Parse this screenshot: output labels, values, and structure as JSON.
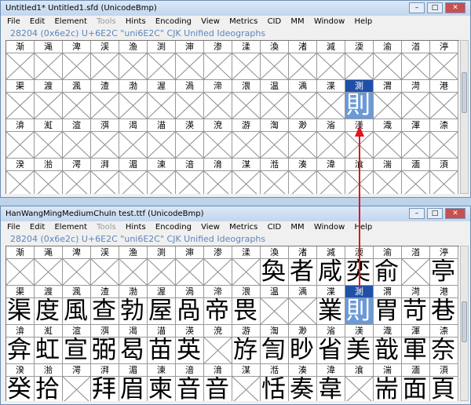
{
  "windows": [
    {
      "title": "Untitled1*  Untitled1.sfd (UnicodeBmp)",
      "menu": [
        "File",
        "Edit",
        "Element",
        "Tools",
        "Hints",
        "Encoding",
        "View",
        "Metrics",
        "CID",
        "MM",
        "Window",
        "Help"
      ],
      "info": "28204 (0x6e2c) U+6E2C \"uni6E2C\" CJK Unified Ideographs",
      "rows": [
        {
          "labels": [
            "渐",
            "渑",
            "渒",
            "渓",
            "渔",
            "渕",
            "渖",
            "渗",
            "渘",
            "渙",
            "渚",
            "減",
            "渜",
            "渝",
            "渞",
            "渟"
          ],
          "glyphs": [
            "",
            "",
            "",
            "",
            "",
            "",
            "",
            "",
            "",
            "",
            "",
            "",
            "",
            "",
            "",
            ""
          ]
        },
        {
          "labels": [
            "渠",
            "渡",
            "渢",
            "渣",
            "渤",
            "渥",
            "渦",
            "渧",
            "渨",
            "温",
            "渪",
            "渫",
            "測",
            "渭",
            "渮",
            "港"
          ],
          "glyphs": [
            "",
            "",
            "",
            "",
            "",
            "",
            "",
            "",
            "",
            "",
            "",
            "",
            "則",
            "",
            "",
            ""
          ]
        },
        {
          "labels": [
            "渰",
            "渱",
            "渲",
            "渳",
            "渴",
            "渵",
            "渶",
            "渷",
            "游",
            "渹",
            "渺",
            "渻",
            "渼",
            "渽",
            "渾",
            "渿"
          ],
          "glyphs": [
            "",
            "",
            "",
            "",
            "",
            "",
            "",
            "",
            "",
            "",
            "",
            "",
            "",
            "",
            "",
            ""
          ]
        },
        {
          "labels": [
            "湀",
            "湁",
            "湂",
            "湃",
            "湄",
            "湅",
            "湆",
            "湇",
            "湈",
            "湉",
            "湊",
            "湋",
            "湌",
            "湍",
            "湎",
            "湏"
          ],
          "glyphs": [
            "",
            "",
            "",
            "",
            "",
            "",
            "",
            "",
            "",
            "",
            "",
            "",
            "",
            "",
            "",
            ""
          ]
        }
      ],
      "selected_row": 1,
      "selected_col": 12
    },
    {
      "title": "HanWangMingMediumChuIn  test.ttf (UnicodeBmp)",
      "menu": [
        "File",
        "Edit",
        "Element",
        "Tools",
        "Hints",
        "Encoding",
        "View",
        "Metrics",
        "CID",
        "MM",
        "Window",
        "Help"
      ],
      "info": "28204 (0x6e2c) U+6E2C \"uni6E2C\" CJK Unified Ideographs",
      "rows": [
        {
          "labels": [
            "渐",
            "渑",
            "渒",
            "渓",
            "渔",
            "渕",
            "渖",
            "渗",
            "渘",
            "渙",
            "渚",
            "減",
            "渜",
            "渝",
            "渞",
            "渟"
          ],
          "glyphs": [
            "",
            "",
            "",
            "",
            "",
            "",
            "",
            "",
            "",
            "奐",
            "者",
            "咸",
            "奕",
            "俞",
            "",
            "亭"
          ]
        },
        {
          "labels": [
            "渠",
            "渡",
            "渢",
            "渣",
            "渤",
            "渥",
            "渦",
            "渧",
            "渨",
            "温",
            "渪",
            "渫",
            "測",
            "渭",
            "渮",
            "港"
          ],
          "glyphs": [
            "渠",
            "度",
            "風",
            "查",
            "勃",
            "屋",
            "咼",
            "帝",
            "畏",
            "",
            "",
            "業",
            "則",
            "胃",
            "苛",
            "巷"
          ]
        },
        {
          "labels": [
            "渰",
            "渱",
            "渲",
            "渳",
            "渴",
            "渵",
            "渶",
            "渷",
            "游",
            "渹",
            "渺",
            "渻",
            "渼",
            "渽",
            "渾",
            "渿"
          ],
          "glyphs": [
            "弇",
            "虹",
            "宣",
            "弼",
            "曷",
            "苗",
            "英",
            "",
            "斿",
            "訇",
            "眇",
            "省",
            "美",
            "戠",
            "軍",
            "奈"
          ]
        },
        {
          "labels": [
            "湀",
            "湁",
            "湂",
            "湃",
            "湄",
            "湅",
            "湆",
            "湇",
            "湈",
            "湉",
            "湊",
            "湋",
            "湌",
            "湍",
            "湎",
            "湏"
          ],
          "glyphs": [
            "癸",
            "拾",
            "",
            "拜",
            "眉",
            "柬",
            "音",
            "音",
            "",
            "恬",
            "奏",
            "韋",
            "",
            "耑",
            "面",
            "頁"
          ]
        }
      ],
      "selected_row": 1,
      "selected_col": 12
    }
  ],
  "window_buttons": {
    "minimize": "–",
    "maximize": "□",
    "close": "✕"
  },
  "colors": {
    "selection": "#1f4fa8",
    "selection_fill": "#6b9ad6",
    "arrow": "#e0141e",
    "info_text": "#5a86c0"
  }
}
